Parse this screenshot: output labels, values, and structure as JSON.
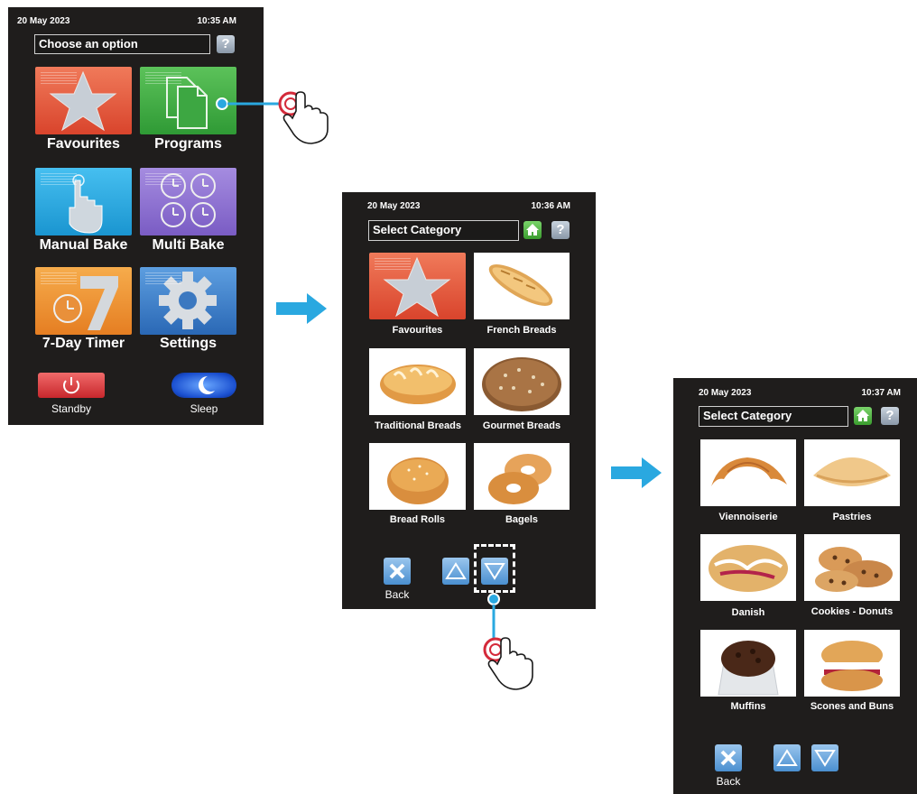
{
  "screen1": {
    "date": "20 May 2023",
    "time": "10:35 AM",
    "title": "Choose an option",
    "help_label": "?",
    "tiles": [
      {
        "label": "Favourites",
        "icon": "star-icon",
        "color": "#e8603f"
      },
      {
        "label": "Programs",
        "icon": "documents-icon",
        "color": "#3aa840"
      },
      {
        "label": "Manual Bake",
        "icon": "hand-pointer-icon",
        "color": "#27a8e0"
      },
      {
        "label": "Multi Bake",
        "icon": "multi-clock-icon",
        "color": "#8b6fd0"
      },
      {
        "label": "7-Day Timer",
        "icon": "seven-clock-icon",
        "color": "#f0962e"
      },
      {
        "label": "Settings",
        "icon": "gear-icon",
        "color": "#3d7cc4"
      }
    ],
    "standby_label": "Standby",
    "sleep_label": "Sleep"
  },
  "screen2": {
    "date": "20 May 2023",
    "time": "10:36 AM",
    "title": "Select Category",
    "help_label": "?",
    "categories": [
      {
        "label": "Favourites",
        "icon": "star-icon"
      },
      {
        "label": "French Breads",
        "icon": "baguette-photo"
      },
      {
        "label": "Traditional Breads",
        "icon": "loaf-photo"
      },
      {
        "label": "Gourmet Breads",
        "icon": "gourmet-loaf-photo"
      },
      {
        "label": "Bread Rolls",
        "icon": "bread-roll-photo"
      },
      {
        "label": "Bagels",
        "icon": "bagel-photo"
      }
    ],
    "back_label": "Back"
  },
  "screen3": {
    "date": "20 May 2023",
    "time": "10:37 AM",
    "title": "Select Category",
    "help_label": "?",
    "categories": [
      {
        "label": "Viennoiserie",
        "icon": "croissant-photo"
      },
      {
        "label": "Pastries",
        "icon": "pastry-photo"
      },
      {
        "label": "Danish",
        "icon": "danish-photo"
      },
      {
        "label": "Cookies - Donuts",
        "icon": "cookies-photo"
      },
      {
        "label": "Muffins",
        "icon": "muffin-photo"
      },
      {
        "label": "Scones and Buns",
        "icon": "scone-photo"
      }
    ],
    "back_label": "Back"
  },
  "colors": {
    "screen_bg": "#1f1d1c",
    "flow_arrow": "#2aa8e0",
    "touch_ring": "#d42a3a"
  }
}
